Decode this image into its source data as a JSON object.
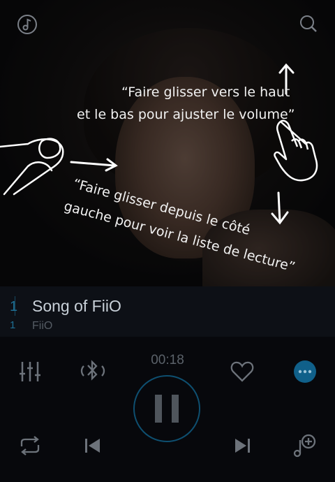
{
  "hints": {
    "swipe_vertical_line1": "“Faire glisser vers le haut",
    "swipe_vertical_line2": "et le bas pour ajuster le volume”",
    "swipe_side_line1": "“Faire glisser depuis le côté",
    "swipe_side_line2": "gauche pour voir la liste de lecture”"
  },
  "track": {
    "number_title": "1",
    "title": "Song of FiiO",
    "number_artist": "1",
    "artist": "FiiO"
  },
  "playback": {
    "elapsed": "00:18",
    "state": "playing"
  },
  "icons": {
    "top_left": "music-note-icon",
    "top_right": "search-icon",
    "equalizer": "equalizer-icon",
    "bluetooth": "bluetooth-icon",
    "favorite": "heart-icon",
    "more": "more-icon",
    "repeat": "repeat-icon",
    "previous": "previous-icon",
    "pause": "pause-icon",
    "next": "next-icon",
    "add_playlist": "add-to-playlist-icon"
  },
  "colors": {
    "accent": "#1e6f94",
    "more_button": "#10608a"
  }
}
